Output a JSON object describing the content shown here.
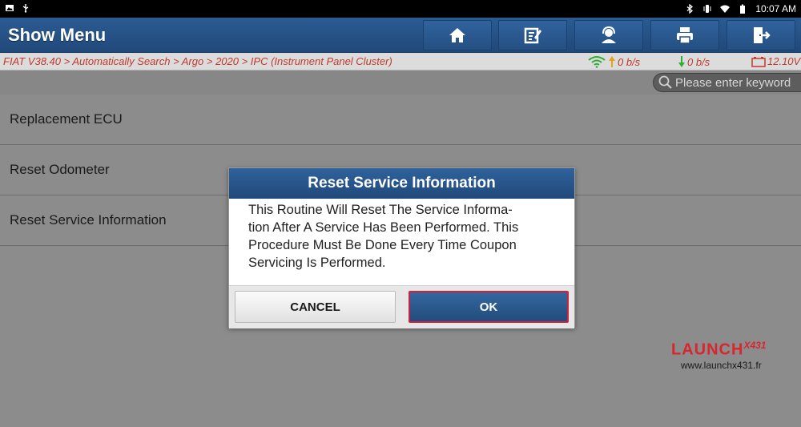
{
  "statusbar": {
    "time": "10:07 AM",
    "icons": [
      "image-icon",
      "usb-icon",
      "bluetooth-icon",
      "vibrate-icon",
      "wifi-icon",
      "battery-icon"
    ]
  },
  "header": {
    "title": "Show Menu",
    "toolbar": [
      "home-icon",
      "edit-icon",
      "support-icon",
      "print-icon",
      "exit-icon"
    ]
  },
  "breadcrumb": {
    "path": "FIAT V38.40 > Automatically Search > Argo > 2020 > IPC (Instrument Panel Cluster)",
    "upload": "0 b/s",
    "download": "0 b/s",
    "voltage": "12.10V"
  },
  "search": {
    "placeholder": "Please enter keyword"
  },
  "list": {
    "items": [
      "Replacement ECU",
      "Reset Odometer",
      "Reset Service Information"
    ]
  },
  "dialog": {
    "title": "Reset Service Information",
    "lines": [
      "This Routine Will Reset The Service Informa-",
      "tion After A Service Has Been Performed. This",
      "Procedure Must Be Done Every Time Coupon",
      "Servicing Is Performed."
    ],
    "cancel_label": "CANCEL",
    "ok_label": "OK"
  },
  "watermark": {
    "brand": "LAUNCH",
    "model": "X431",
    "url": "www.launchx431.fr"
  },
  "colors": {
    "header_blue": "#2b5b93",
    "crumb_red": "#c0392b",
    "ok_border": "#d21f3c"
  }
}
